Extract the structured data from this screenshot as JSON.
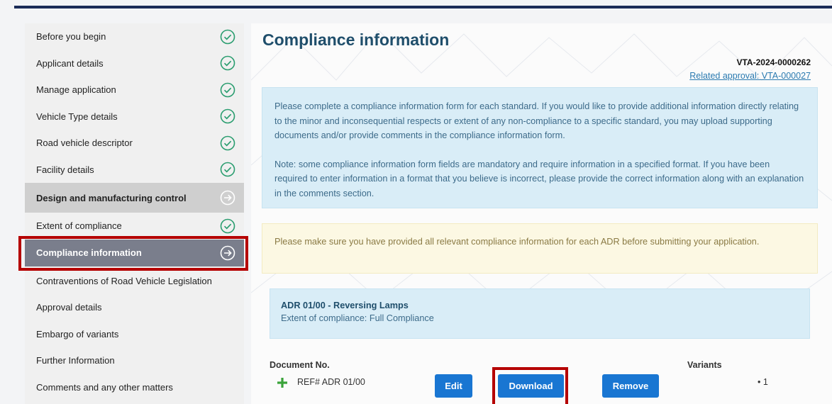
{
  "sidebar": {
    "items": [
      {
        "label": "Before you begin",
        "status": "complete"
      },
      {
        "label": "Applicant details",
        "status": "complete"
      },
      {
        "label": "Manage application",
        "status": "complete"
      },
      {
        "label": "Vehicle Type details",
        "status": "complete"
      },
      {
        "label": "Road vehicle descriptor",
        "status": "complete"
      },
      {
        "label": "Facility details",
        "status": "complete"
      },
      {
        "label": "Design and manufacturing control",
        "status": "current-section"
      },
      {
        "label": "Extent of compliance",
        "status": "complete"
      },
      {
        "label": "Compliance information",
        "status": "active"
      },
      {
        "label": "Contraventions of Road Vehicle Legislation",
        "status": "none"
      },
      {
        "label": "Approval details",
        "status": "none"
      },
      {
        "label": "Embargo of variants",
        "status": "none"
      },
      {
        "label": "Further Information",
        "status": "none"
      },
      {
        "label": "Comments and any other matters",
        "status": "none"
      }
    ]
  },
  "main": {
    "title": "Compliance information",
    "ref_id": "VTA-2024-0000262",
    "related_approval": "Related approval: VTA-000027",
    "info_p1": "Please complete a compliance information form for each standard. If you would like to provide additional information directly relating to the minor and inconsequential respects or extent of any non-compliance to a specific standard, you may upload supporting documents and/or provide comments in the compliance information form.",
    "info_p2": "Note: some compliance information form fields are mandatory and require information in a specified format. If you have been required to enter information in a format that you believe is incorrect, please provide the correct information along with an explanation in the comments section.",
    "warning": "Please make sure you have provided all relevant compliance information for each ADR before submitting your application.",
    "adr": {
      "title": "ADR 01/00 - Reversing Lamps",
      "extent": "Extent of compliance: Full Compliance"
    },
    "table": {
      "doc_header": "Document No.",
      "variants_header": "Variants",
      "row": {
        "ref": "REF# ADR 01/00",
        "edit_label": "Edit",
        "download_label": "Download",
        "remove_label": "Remove",
        "variant": "• 1"
      }
    }
  },
  "colors": {
    "accent": "#1976d2",
    "highlight": "#b50000",
    "check": "#2a9d6f"
  }
}
